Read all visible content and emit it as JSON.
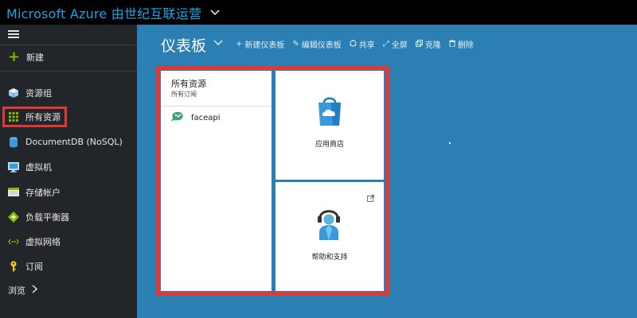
{
  "topbar": {
    "title": "Microsoft Azure 由世纪互联运营"
  },
  "sidebar": {
    "new_label": "新建",
    "items": [
      {
        "label": "资源组",
        "icon": "resource-group-icon"
      },
      {
        "label": "所有资源",
        "icon": "grid-icon",
        "active": true
      },
      {
        "label": "DocumentDB (NoSQL)",
        "icon": "documentdb-icon"
      },
      {
        "label": "虚拟机",
        "icon": "virtual-machine-icon"
      },
      {
        "label": "存储帐户",
        "icon": "storage-icon"
      },
      {
        "label": "负载平衡器",
        "icon": "load-balancer-icon"
      },
      {
        "label": "虚拟网络",
        "icon": "virtual-network-icon"
      },
      {
        "label": "订阅",
        "icon": "key-icon"
      }
    ],
    "browse_label": "浏览"
  },
  "dashboard": {
    "title": "仪表板",
    "toolbar": {
      "new_label": "新建仪表板",
      "edit_label": "编辑仪表板",
      "share_label": "共享",
      "fullscreen_label": "全屏",
      "clone_label": "克隆",
      "delete_label": "删除"
    }
  },
  "tiles": {
    "all_resources": {
      "title": "所有资源",
      "subtitle": "所有订阅",
      "items": [
        {
          "name": "faceapi"
        }
      ]
    },
    "store": {
      "label": "应用商店"
    },
    "help": {
      "label": "帮助和支持"
    }
  },
  "colors": {
    "brand": "#1aa5e6",
    "main_bg": "#2b7fb3",
    "sidebar_bg": "#22262a",
    "highlight": "#e03737",
    "new_accent": "#7fba00"
  }
}
